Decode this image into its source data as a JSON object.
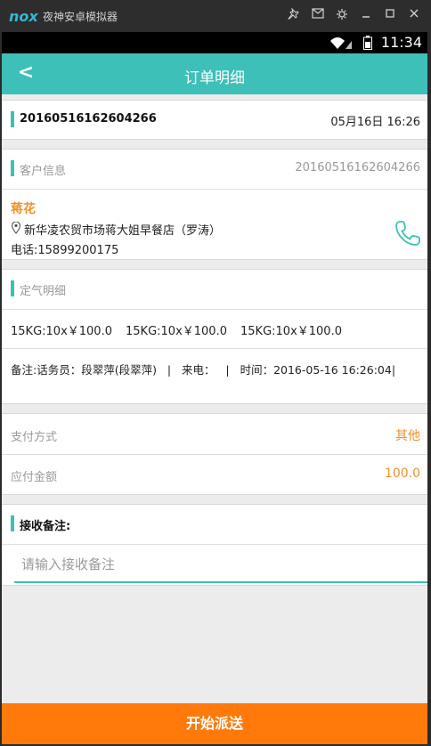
{
  "emulator": {
    "logo": "nox",
    "title": "夜神安卓模拟器",
    "controls": [
      "pin-icon",
      "message-icon",
      "settings-icon",
      "minimize-icon",
      "maximize-icon",
      "close-icon"
    ]
  },
  "status_bar": {
    "time": "11:34"
  },
  "app_bar": {
    "back": "<",
    "title": "订单明细"
  },
  "order": {
    "id": "20160516162604266",
    "date": "05月16日 16:26"
  },
  "customer": {
    "section_label": "客户信息",
    "section_value": "20160516162604266",
    "name": "蒋花",
    "address": "新华凌农贸市场蒋大姐早餐店（罗涛）",
    "phone": "电话:15899200175"
  },
  "gas": {
    "section_label": "定气明细",
    "items": [
      "15KG:10x￥100.0",
      "15KG:10x￥100.0",
      "15KG:10x￥100.0"
    ],
    "remark": "备注:话务员：段翠萍(段翠萍)   |   来电：   |   时间：2016-05-16 16:26:04|"
  },
  "payment": {
    "method_label": "支付方式",
    "method_value": "其他",
    "amount_label": "应付金额",
    "amount_value": "100.0"
  },
  "receive": {
    "label": "接收备注:",
    "placeholder": "请输入接收备注"
  },
  "action": {
    "label": "开始派送"
  },
  "colors": {
    "accent": "#3cc0b7",
    "orange": "#ff7a0b",
    "text_orange": "#f2902a"
  }
}
